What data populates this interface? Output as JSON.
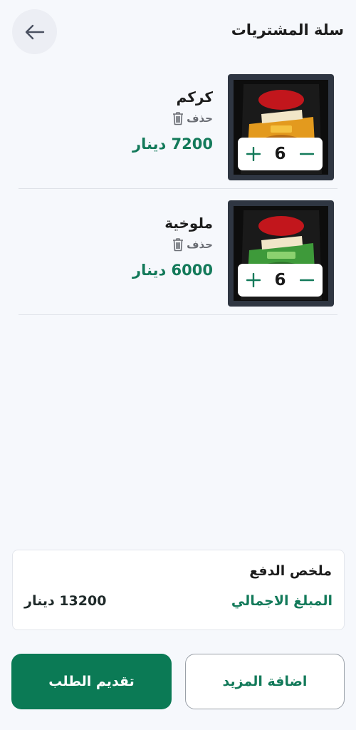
{
  "header": {
    "title": "سلة المشتريات",
    "back_icon": "arrow-left-icon"
  },
  "cart": {
    "items": [
      {
        "name": "كركم",
        "delete_label": "حذف",
        "price": "7200 دينار",
        "quantity": "6",
        "image_icon": "turmeric-package-image",
        "package_color": "#e39a1e",
        "package_text": "كركم"
      },
      {
        "name": "ملوخية",
        "delete_label": "حذف",
        "price": "6000 دينار",
        "quantity": "6",
        "image_icon": "molokhia-package-image",
        "package_color": "#3e9a3a",
        "package_text": "ملوخية"
      }
    ]
  },
  "summary": {
    "title": "ملخص الدفع",
    "total_label": "المبلغ الاجمالي",
    "total_value": "13200 دينار"
  },
  "actions": {
    "submit_label": "تقديم الطلب",
    "add_more_label": "اضافة المزيد"
  },
  "colors": {
    "accent": "#0b7a55",
    "price_green": "#137a5a",
    "background": "#f6f8fc",
    "thumb_bg": "#2f3642"
  }
}
